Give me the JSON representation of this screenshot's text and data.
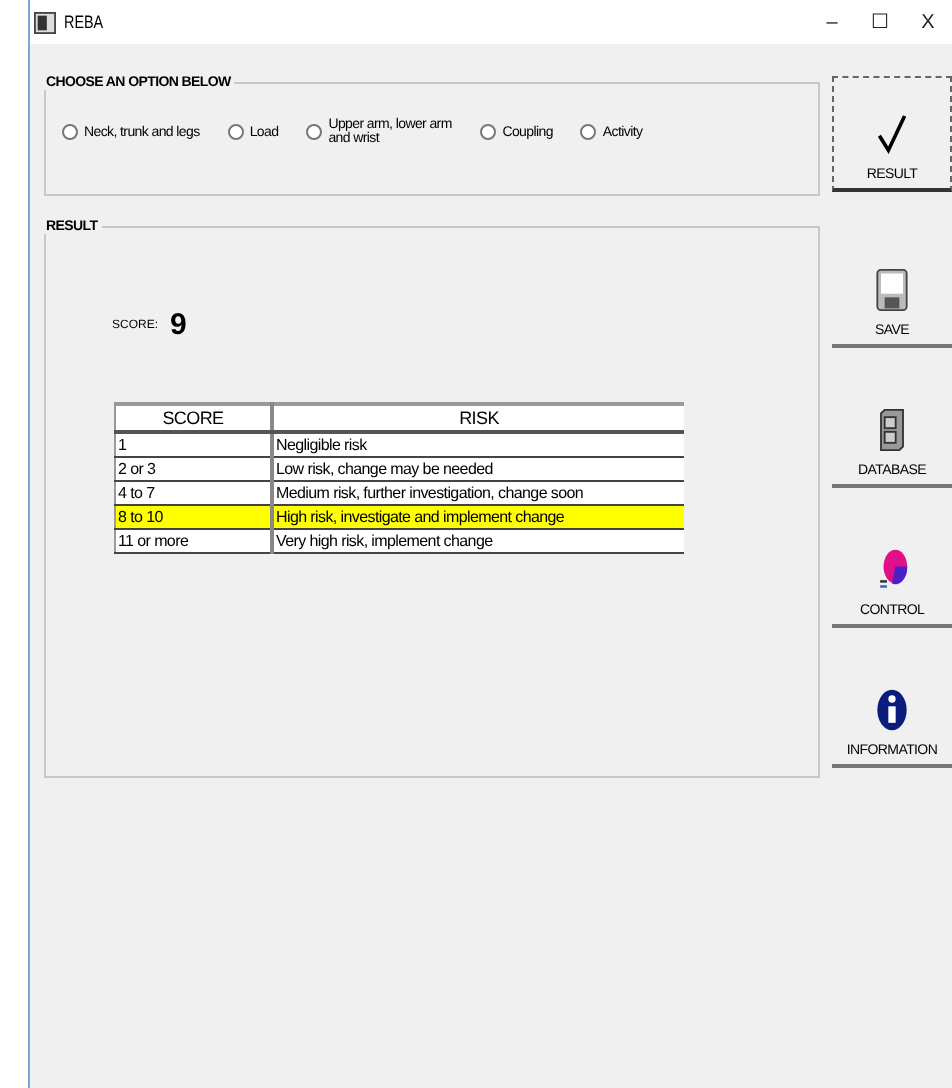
{
  "window": {
    "title": "REBA",
    "controls": [
      "–",
      "☐",
      "X"
    ]
  },
  "options": {
    "title": "CHOOSE AN OPTION BELOW",
    "items": [
      {
        "label": "Neck, trunk and legs",
        "selected": false
      },
      {
        "label": "Load",
        "selected": false
      },
      {
        "label": "Upper arm, lower arm and wrist",
        "selected": false
      },
      {
        "label": "Coupling",
        "selected": false
      },
      {
        "label": "Activity",
        "selected": false
      }
    ]
  },
  "result": {
    "title": "RESULT",
    "score_label": "SCORE:",
    "score": "9",
    "table": {
      "columns": [
        "SCORE",
        "RISK"
      ],
      "rows": [
        {
          "cells": [
            "1",
            "Negligible risk"
          ],
          "selected": false
        },
        {
          "cells": [
            "2 or 3",
            "Low risk, change may be needed"
          ],
          "selected": false
        },
        {
          "cells": [
            "4 to 7",
            "Medium risk, further investigation, change soon"
          ],
          "selected": false
        },
        {
          "cells": [
            "8 to 10",
            "High risk, investigate and implement change"
          ],
          "selected": true
        },
        {
          "cells": [
            "11 or more",
            "Very high risk, implement change"
          ],
          "selected": false
        }
      ]
    }
  },
  "side_buttons": [
    {
      "kind": "check",
      "label": "RESULT"
    },
    {
      "kind": "save",
      "label": "SAVE"
    },
    {
      "kind": "database",
      "label": "DATABASE"
    },
    {
      "kind": "control",
      "label": "CONTROL"
    },
    {
      "kind": "info",
      "label": "INFORMATION"
    }
  ]
}
